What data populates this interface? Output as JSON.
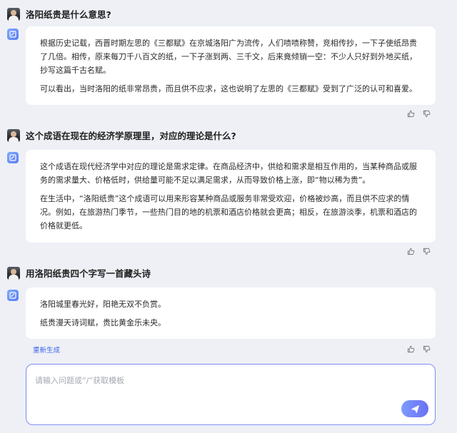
{
  "conversation": [
    {
      "question": "洛阳纸贵是什么意思?",
      "answer_paragraphs": [
        "根据历史记载，西晋时期左思的《三都赋》在京城洛阳广为流传，人们啧啧称赞，竞相传抄，一下子使纸昂贵了几倍。相传，原来每刀千八百文的纸，一下子涨到两、三千文，后来竟倾销一空：不少人只好到外地买纸，抄写这篇千古名赋。",
        "可以看出，当时洛阳的纸非常昂贵，而且供不应求，这也说明了左思的《三都赋》受到了广泛的认可和喜爱。"
      ]
    },
    {
      "question": "这个成语在现在的经济学原理里，对应的理论是什么?",
      "answer_paragraphs": [
        "这个成语在现代经济学中对应的理论是需求定律。在商品经济中，供给和需求是相互作用的，当某种商品或服务的需求量大、价格低时，供给量可能不足以满足需求，从而导致价格上涨，即“物以稀为贵”。",
        "在生活中，“洛阳纸贵”这个成语可以用来形容某种商品或服务非常受欢迎，价格被炒高，而且供不应求的情况。例如，在旅游热门季节，一些热门目的地的机票和酒店价格就会更高；相反，在旅游淡季，机票和酒店的价格就更低。"
      ]
    },
    {
      "question": "用洛阳纸贵四个字写一首藏头诗",
      "answer_paragraphs": [
        "洛阳城里春光好，阳艳无双不负赏。",
        "纸贵漫天诗词赋，贵比黄金乐未央。"
      ]
    }
  ],
  "regenerate_label": "重新生成",
  "input": {
    "placeholder": "请输入问题或“/”获取模板",
    "value": ""
  },
  "icons": {
    "bot": "chat-bot-icon",
    "like": "thumbs-up-icon",
    "dislike": "thumbs-down-icon",
    "send": "paper-plane-icon"
  },
  "colors": {
    "background": "#eef0f6",
    "accent": "#6a6ff5",
    "link": "#3f63e8"
  }
}
